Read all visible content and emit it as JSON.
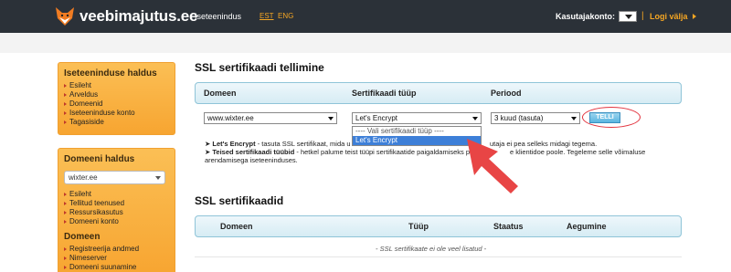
{
  "header": {
    "logo_text": "veebimajutus.ee",
    "nav_self": "Iseteenindus",
    "lang_est": "EST",
    "lang_eng": "ENG",
    "account_label": "Kasutajakonto:",
    "separator": "|",
    "logout": "Logi välja"
  },
  "sidebar": {
    "box1": {
      "title": "Iseteeninduse haldus",
      "items": [
        "Esileht",
        "Arveldus",
        "Domeenid",
        "Iseteeninduse konto",
        "Tagasiside"
      ]
    },
    "box2": {
      "title": "Domeeni haldus",
      "domain_select": "wixter.ee",
      "items": [
        "Esileht",
        "Tellitud teenused",
        "Ressursikasutus",
        "Domeeni konto"
      ],
      "title2": "Domeen",
      "items2": [
        "Registreerija andmed",
        "Nimeserver",
        "Domeeni suunamine"
      ]
    }
  },
  "order": {
    "title": "SSL sertifikaadi tellimine",
    "col_domain": "Domeen",
    "col_type": "Sertifikaadi tüüp",
    "col_period": "Periood",
    "domain_value": "www.wixter.ee",
    "type_value": "Let's Encrypt",
    "period_value": "3 kuud (tasuta)",
    "submit": "TELLI",
    "dropdown_options": [
      "---- Vali sertifikaadi tüüp ----",
      "Let's Encrypt"
    ],
    "desc_line1_bold": "Let's Encrypt",
    "desc_line1_a": " - tasuta SSL sertifikaat, mida u",
    "desc_line1_b": "utaja ei pea selleks midagi tegema.",
    "desc_line2_bold": "Teised sertifikaadi tüübid",
    "desc_line2_a": " - hetkel palume teist tüüpi sertifikaatide paigaldamiseks p",
    "desc_line2_b": "e klientidoe poole. Tegeleme selle võimaluse",
    "desc_line3": "arendamisega iseteeninduses."
  },
  "certs": {
    "title": "SSL sertifikaadid",
    "col_domain": "Domeen",
    "col_type": "Tüüp",
    "col_status": "Staatus",
    "col_expiry": "Aegumine",
    "empty": "- SSL sertifikaate ei ole veel lisatud -"
  },
  "colors": {
    "topbar": "#2b3138",
    "accent": "#f5a623",
    "sidebar": "#f7a531",
    "highlight": "#e2323d",
    "selected": "#3d7fd8"
  }
}
